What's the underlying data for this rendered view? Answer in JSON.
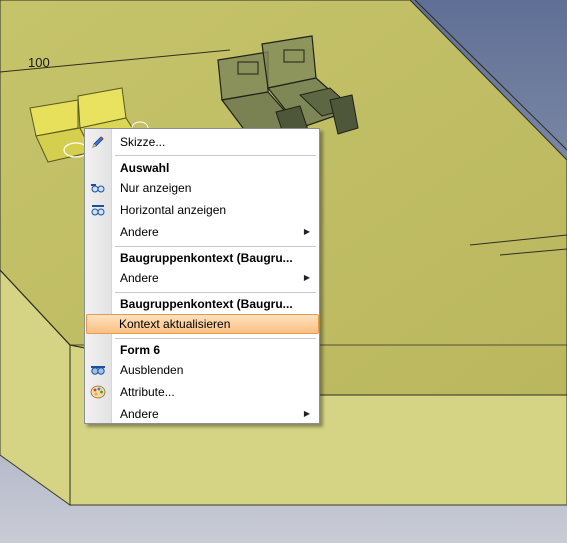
{
  "scene": {
    "dimension_label": "100",
    "colors": {
      "background": "#8f98b0",
      "plate_top": "#c8c66c",
      "plate_side": "#d8d88a",
      "part": "#6f7a55"
    }
  },
  "context_menu": {
    "items": [
      {
        "type": "item",
        "label": "Skizze...",
        "icon": "pencil-icon"
      },
      {
        "type": "separator"
      },
      {
        "type": "header",
        "label": "Auswahl"
      },
      {
        "type": "item",
        "label": "Nur anzeigen",
        "icon": "show-only-icon"
      },
      {
        "type": "item",
        "label": "Horizontal anzeigen",
        "icon": "show-horizontal-icon"
      },
      {
        "type": "item",
        "label": "Andere",
        "submenu": true
      },
      {
        "type": "separator"
      },
      {
        "type": "header",
        "label": "Baugruppenkontext (Baugru..."
      },
      {
        "type": "item",
        "label": "Andere",
        "submenu": true
      },
      {
        "type": "separator"
      },
      {
        "type": "header",
        "label": "Baugruppenkontext (Baugru..."
      },
      {
        "type": "item",
        "label": "Kontext aktualisieren",
        "highlighted": true
      },
      {
        "type": "separator"
      },
      {
        "type": "header",
        "label": "Form 6"
      },
      {
        "type": "item",
        "label": "Ausblenden",
        "icon": "hide-icon"
      },
      {
        "type": "item",
        "label": "Attribute...",
        "icon": "palette-icon"
      },
      {
        "type": "item",
        "label": "Andere",
        "submenu": true
      }
    ]
  }
}
